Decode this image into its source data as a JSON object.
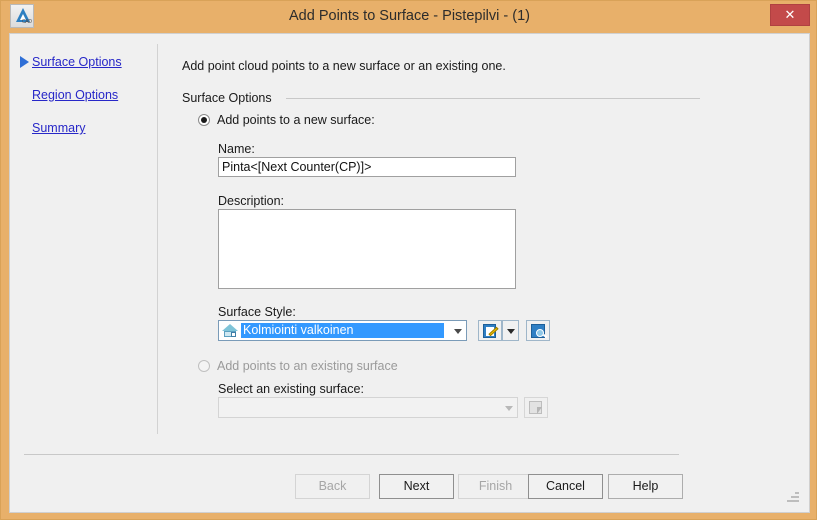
{
  "window": {
    "title": "Add Points to Surface - Pistepilvi - (1)",
    "app_icon": "autocad-icon",
    "cad_text": "CAD",
    "close_label": "✕",
    "frame_color": "#e8b06a",
    "close_color": "#c34a4a"
  },
  "sidebar": {
    "items": [
      {
        "label": "Surface Options",
        "selected": true
      },
      {
        "label": "Region Options",
        "selected": false
      },
      {
        "label": "Summary",
        "selected": false
      }
    ],
    "link_color": "#2727c8",
    "arrow_color": "#2f6fd6"
  },
  "main": {
    "intro": "Add point cloud points to a new surface or an existing one.",
    "group": {
      "label": "Surface Options"
    },
    "new_surface": {
      "radio_label": "Add points to a new surface:",
      "checked": true,
      "name_label": "Name:",
      "name_value": "Pinta<[Next Counter(CP)]>",
      "description_label": "Description:",
      "description_value": "",
      "style_label": "Surface Style:",
      "style_value": "Kolmiointi valkoinen",
      "style_icon": "surface-style-icon",
      "style_selected_highlight": "#3399ff",
      "edit_button_icon": "edit-pencil-icon",
      "edit_dropdown_icon": "chevron-down-icon",
      "preview_button_icon": "preview-magnifier-icon"
    },
    "existing_surface": {
      "radio_label": "Add points to an existing surface",
      "checked": false,
      "disabled": true,
      "select_label": "Select an existing surface:",
      "select_value": "",
      "pick_button_icon": "pick-object-icon"
    }
  },
  "footer": {
    "buttons": [
      {
        "label": "Back",
        "disabled": true
      },
      {
        "label": "Next",
        "disabled": false
      },
      {
        "label": "Finish",
        "disabled": true
      },
      {
        "label": "Cancel",
        "disabled": false
      },
      {
        "label": "Help",
        "disabled": false
      }
    ]
  }
}
